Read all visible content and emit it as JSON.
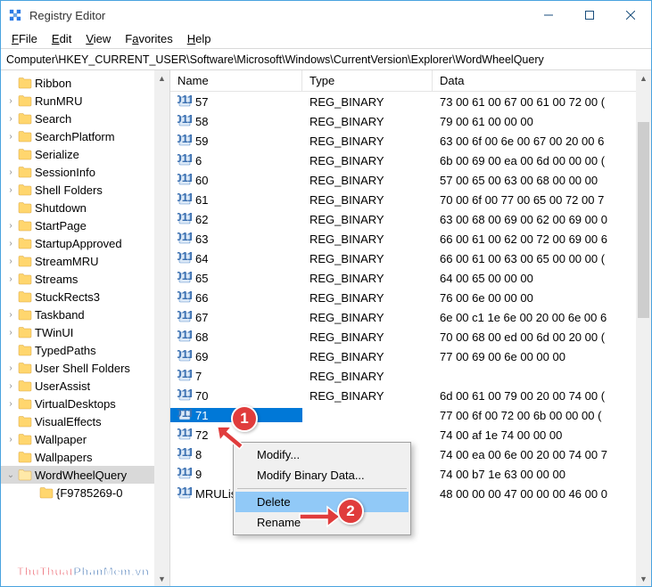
{
  "window": {
    "title": "Registry Editor"
  },
  "menubar": [
    "File",
    "Edit",
    "View",
    "Favorites",
    "Help"
  ],
  "address": "Computer\\HKEY_CURRENT_USER\\Software\\Microsoft\\Windows\\CurrentVersion\\Explorer\\WordWheelQuery",
  "tree": [
    {
      "caret": "",
      "name": "Ribbon"
    },
    {
      "caret": ">",
      "name": "RunMRU"
    },
    {
      "caret": ">",
      "name": "Search"
    },
    {
      "caret": ">",
      "name": "SearchPlatform"
    },
    {
      "caret": "",
      "name": "Serialize"
    },
    {
      "caret": ">",
      "name": "SessionInfo"
    },
    {
      "caret": ">",
      "name": "Shell Folders"
    },
    {
      "caret": "",
      "name": "Shutdown"
    },
    {
      "caret": ">",
      "name": "StartPage"
    },
    {
      "caret": ">",
      "name": "StartupApproved"
    },
    {
      "caret": ">",
      "name": "StreamMRU"
    },
    {
      "caret": ">",
      "name": "Streams"
    },
    {
      "caret": "",
      "name": "StuckRects3"
    },
    {
      "caret": ">",
      "name": "Taskband"
    },
    {
      "caret": ">",
      "name": "TWinUI"
    },
    {
      "caret": "",
      "name": "TypedPaths"
    },
    {
      "caret": ">",
      "name": "User Shell Folders"
    },
    {
      "caret": ">",
      "name": "UserAssist"
    },
    {
      "caret": ">",
      "name": "VirtualDesktops"
    },
    {
      "caret": "",
      "name": "VisualEffects"
    },
    {
      "caret": ">",
      "name": "Wallpaper"
    },
    {
      "caret": "",
      "name": "Wallpapers"
    },
    {
      "caret": "v",
      "name": "WordWheelQuery",
      "selected": true,
      "open": true
    },
    {
      "caret": "",
      "name": "{F9785269-0",
      "indent": true
    }
  ],
  "columns": {
    "name": "Name",
    "type": "Type",
    "data": "Data"
  },
  "rows": [
    {
      "name": "57",
      "type": "REG_BINARY",
      "data": "73 00 61 00 67 00 61 00 72 00 ("
    },
    {
      "name": "58",
      "type": "REG_BINARY",
      "data": "79 00 61 00 00 00"
    },
    {
      "name": "59",
      "type": "REG_BINARY",
      "data": "63 00 6f 00 6e 00 67 00 20 00 6"
    },
    {
      "name": "6",
      "type": "REG_BINARY",
      "data": "6b 00 69 00 ea 00 6d 00 00 00 ("
    },
    {
      "name": "60",
      "type": "REG_BINARY",
      "data": "57 00 65 00 63 00 68 00 00 00"
    },
    {
      "name": "61",
      "type": "REG_BINARY",
      "data": "70 00 6f 00 77 00 65 00 72 00 7"
    },
    {
      "name": "62",
      "type": "REG_BINARY",
      "data": "63 00 68 00 69 00 62 00 69 00 0"
    },
    {
      "name": "63",
      "type": "REG_BINARY",
      "data": "66 00 61 00 62 00 72 00 69 00 6"
    },
    {
      "name": "64",
      "type": "REG_BINARY",
      "data": "66 00 61 00 63 00 65 00 00 00 ("
    },
    {
      "name": "65",
      "type": "REG_BINARY",
      "data": "64 00 65 00 00 00"
    },
    {
      "name": "66",
      "type": "REG_BINARY",
      "data": "76 00 6e 00 00 00"
    },
    {
      "name": "67",
      "type": "REG_BINARY",
      "data": "6e 00 c1 1e 6e 00 20 00 6e 00 6"
    },
    {
      "name": "68",
      "type": "REG_BINARY",
      "data": "70 00 68 00 ed 00 6d 00 20 00 ("
    },
    {
      "name": "69",
      "type": "REG_BINARY",
      "data": "77 00 69 00 6e 00 00 00"
    },
    {
      "name": "7",
      "type": "REG_BINARY",
      "data": ""
    },
    {
      "name": "70",
      "type": "REG_BINARY",
      "data": "6d 00 61 00 79 00 20 00 74 00 ("
    },
    {
      "name": "71",
      "type": "",
      "data": "77 00 6f 00 72 00 6b 00 00 00 (",
      "selected": true
    },
    {
      "name": "72",
      "type": "",
      "data": "74 00 af 1e 74 00 00 00"
    },
    {
      "name": "8",
      "type": "",
      "data": "74 00 ea 00 6e 00 20 00 74 00 7"
    },
    {
      "name": "9",
      "type": "",
      "data": "74 00 b7 1e 63 00 00 00"
    },
    {
      "name": "MRUListEx",
      "type": "",
      "data": "48 00 00 00 47 00 00 00 46 00 0"
    }
  ],
  "context": {
    "modify": "Modify...",
    "modifyBinary": "Modify Binary Data...",
    "delete": "Delete",
    "rename": "Rename"
  },
  "watermark": {
    "a": "ThuThuat",
    "b": "PhanMem.vn"
  }
}
